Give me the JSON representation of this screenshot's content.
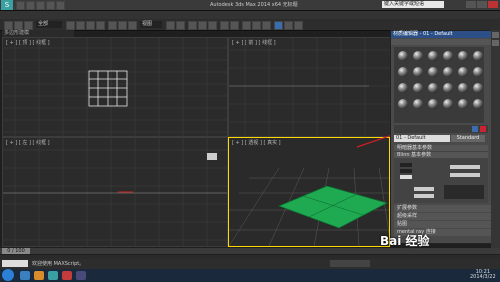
{
  "window": {
    "title": "Autodesk 3ds Max  2014 x64    无标题",
    "search_placeholder": "键入关键字或短语"
  },
  "toolbar": {
    "selection_filter": "全部",
    "view_label": "视图"
  },
  "ribbon": {
    "label": "多边形建模"
  },
  "viewports": {
    "top": "[ + ] [ 顶 ] [ 线框 ]",
    "front": "[ + ] [ 前 ] [ 线框 ]",
    "left": "[ + ] [ 左 ] [ 线框 ]",
    "perspective": "[ + ] [ 透视 ] [ 真实 ]"
  },
  "material_editor": {
    "title": "材质编辑器 - 01 - Default",
    "menu": [
      "模式",
      "材质",
      "导航",
      "选项",
      "实用程序"
    ],
    "slot_name": "01 - Default",
    "type_button": "Standard",
    "rollouts": [
      "明暗器基本参数",
      "Blinn 基本参数",
      "扩展参数",
      "超级采样",
      "贴图",
      "mental ray 连接"
    ]
  },
  "statusbar": {
    "frame_counter": "0 / 100",
    "prompt": "欢迎使用 MAXScript。"
  },
  "watermark": {
    "text": "Bai 经验"
  },
  "clock": {
    "time": "10:21",
    "date": "2014/3/22"
  },
  "colors": {
    "accent_border": "#ffd800",
    "plane_green": "#1faa52",
    "selection_line": "#d02020"
  },
  "icons": [
    "3dsmax-logo-icon",
    "undo-icon",
    "redo-icon",
    "select-icon",
    "move-icon",
    "rotate-icon",
    "scale-icon",
    "render-icon",
    "start-icon"
  ]
}
